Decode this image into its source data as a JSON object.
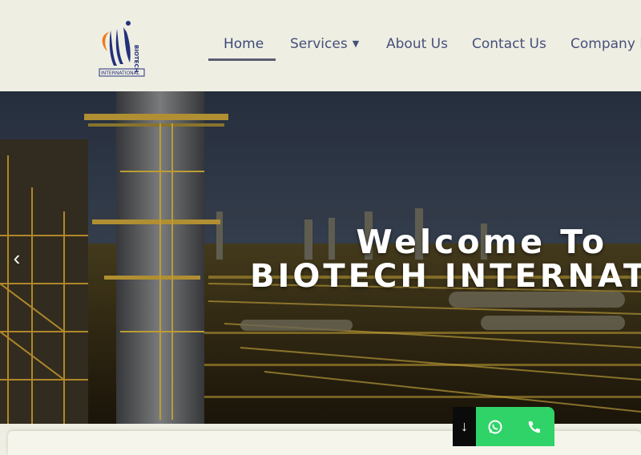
{
  "brand": {
    "logo_text_top": "BIOTECH",
    "logo_text_bottom": "INTERNATIONAL",
    "colors": {
      "orange": "#f07a1a",
      "navy": "#23307a"
    }
  },
  "nav": {
    "items": [
      {
        "label": "Home",
        "active": true
      },
      {
        "label": "Services",
        "has_dropdown": true
      },
      {
        "label": "About Us"
      },
      {
        "label": "Contact Us"
      },
      {
        "label": "Company P"
      }
    ]
  },
  "hero": {
    "title": "Welcome To",
    "subtitle": "BIOTECH INTERNATIONAL",
    "prev_icon": "chevron-left-icon"
  },
  "floating": {
    "scroll_icon": "arrow-down-icon",
    "whatsapp_icon": "whatsapp-icon",
    "call_icon": "phone-icon",
    "accent": "#2fd368"
  }
}
